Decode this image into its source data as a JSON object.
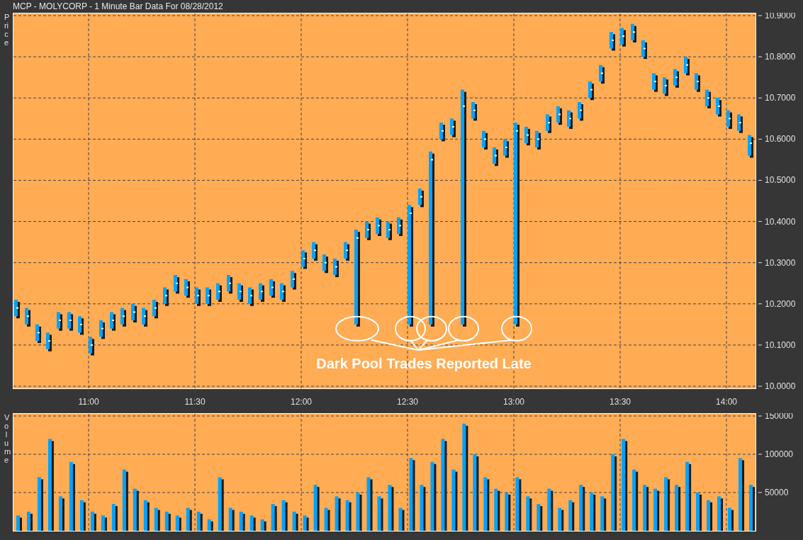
{
  "window": {
    "title": "MCP - MOLYCORP - 1 Minute Bar Data For 08/28/2012"
  },
  "price_chart": {
    "axis_title": "Price",
    "price_labels": [
      "10.9000",
      "10.8000",
      "10.7000",
      "10.6000",
      "10.5000",
      "10.4000",
      "10.3000",
      "10.2000",
      "10.1000",
      "10.0000"
    ],
    "time_labels": [
      "11:00",
      "11:30",
      "12:00",
      "12:30",
      "13:00",
      "13:30",
      "14:00"
    ],
    "annotation": "Dark Pool Trades Reported Late"
  },
  "volume_chart": {
    "chart_data": {
      "type": "bar",
      "ylabel": "Volume",
      "grid": true,
      "categories": [
        null,
        null,
        null,
        null,
        null,
        null,
        null,
        null,
        null,
        null,
        null,
        null,
        null,
        null,
        null,
        null,
        null,
        null,
        null,
        null,
        null,
        null,
        null,
        null,
        null,
        null,
        null,
        null,
        null,
        null,
        null,
        null,
        null,
        null,
        null,
        null,
        null,
        null,
        null,
        null,
        null,
        null,
        null,
        null,
        null,
        null,
        null,
        null,
        null,
        null,
        null,
        null,
        null,
        null,
        null,
        null,
        null,
        null,
        null,
        null,
        null,
        null,
        null,
        null,
        null,
        null,
        null,
        null,
        null,
        null
      ],
      "series": [
        {
          "color": "#00a2ff",
          "values": [
            20000,
            25000,
            70000,
            120000,
            45000,
            90000,
            40000,
            25000,
            20000,
            35000,
            80000,
            55000,
            40000,
            30000,
            25000,
            20000,
            30000,
            25000,
            15000,
            70000,
            30000,
            25000,
            20000,
            15000,
            35000,
            40000,
            25000,
            20000,
            60000,
            30000,
            45000,
            40000,
            50000,
            70000,
            45000,
            60000,
            30000,
            95000,
            60000,
            90000,
            120000,
            80000,
            140000,
            100000,
            70000,
            55000,
            50000,
            70000,
            45000,
            35000,
            55000,
            30000,
            40000,
            60000,
            50000,
            45000,
            100000,
            120000,
            80000,
            60000,
            55000,
            70000,
            60000,
            90000,
            50000,
            40000,
            45000,
            30000,
            95000,
            60000
          ]
        }
      ],
      "ylim": [
        0,
        150000
      ],
      "yticks": [
        {
          "value": 50000,
          "label": "50000"
        },
        {
          "value": 100000,
          "label": "100000"
        },
        {
          "value": 150000,
          "label": "150000"
        }
      ]
    }
  }
}
